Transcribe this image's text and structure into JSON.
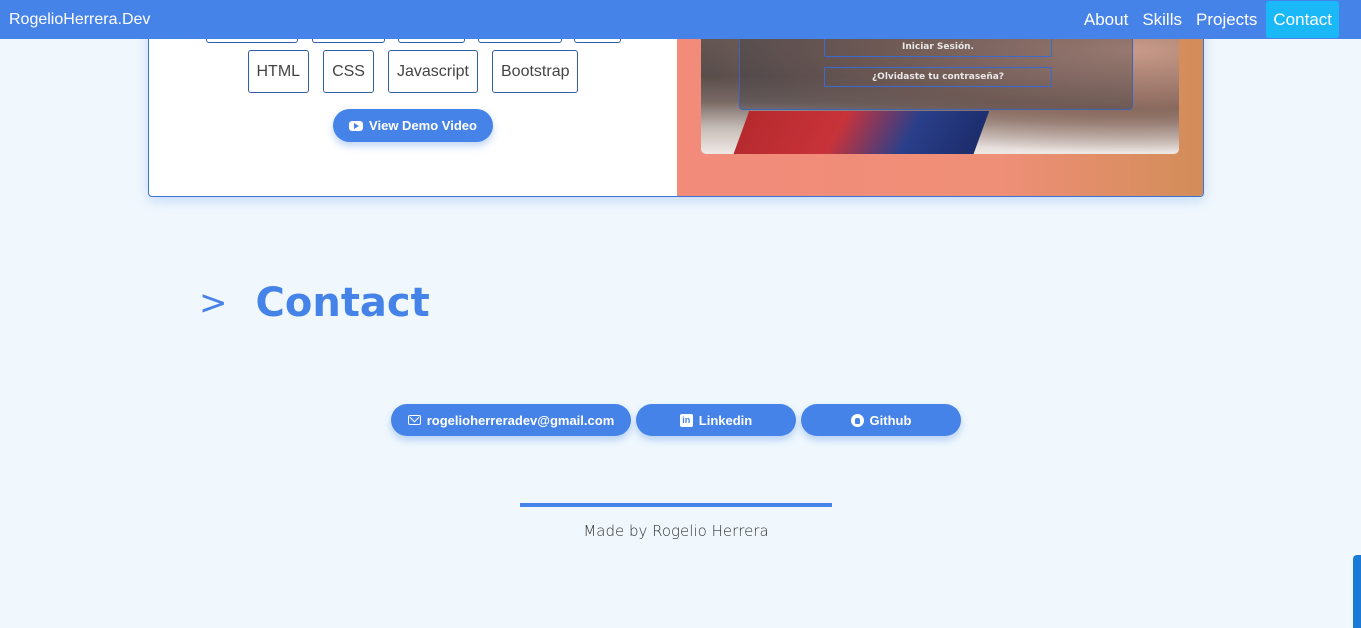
{
  "navbar": {
    "brand": "RogelioHerrera.Dev",
    "links": [
      {
        "label": "About"
      },
      {
        "label": "Skills"
      },
      {
        "label": "Projects"
      },
      {
        "label": "Contact",
        "active": true
      }
    ]
  },
  "project_card": {
    "tags": [
      "HTML",
      "CSS",
      "Javascript",
      "Bootstrap"
    ],
    "demo_button": "View Demo Video",
    "screenshot": {
      "login_button": "Iniciar Sesión.",
      "forgot_button": "¿Olvidaste tu contraseña?"
    }
  },
  "contact": {
    "chevron": ">",
    "title": "Contact",
    "buttons": {
      "email": "rogelioherreradev@gmail.com",
      "linkedin": "Linkedin",
      "github": "Github"
    }
  },
  "footer": {
    "text": "Made by Rogelio Herrera"
  },
  "colors": {
    "accent": "#4683e8",
    "active_nav": "#1ab8f7",
    "background": "#f0f8fd"
  }
}
